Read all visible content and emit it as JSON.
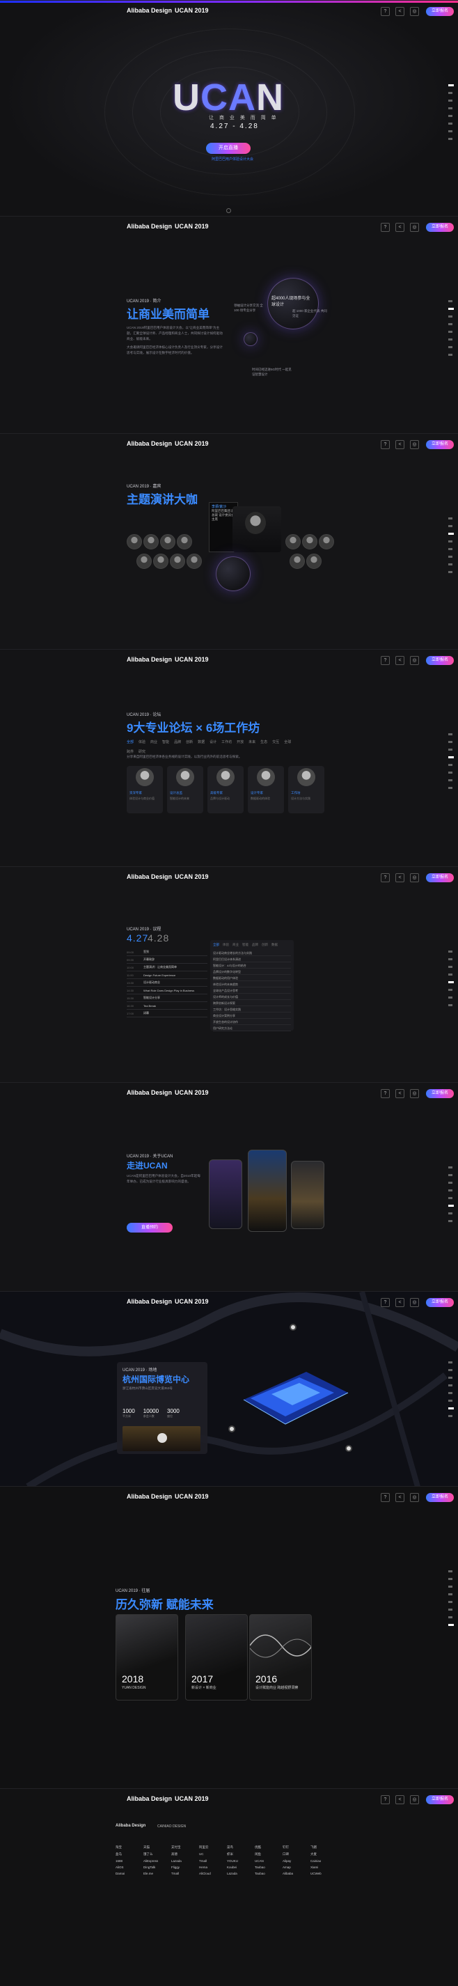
{
  "header": {
    "brand": "Alibaba Design",
    "event": "UCAN 2019",
    "buttons": [
      "?",
      "<",
      "◎"
    ],
    "register_label": "立即报名"
  },
  "hero": {
    "logo_prefix": "U",
    "logo_highlight": "CA",
    "logo_suffix": "N",
    "tagline": "让 商 业 美 而 简 单",
    "dates": "4.27 - 4.28",
    "live_button": "开启直播",
    "live_sub": "阿里巴巴用户体验设计大会"
  },
  "intro": {
    "eyebrow": "UCAN 2019 · 简介",
    "title": "让商业美而简单",
    "paragraphs": [
      "UCAN 2019阿里巴巴用户体验设计大会，以“让商业美而简单”为主题，汇聚全球设计师、产品经理和商业人士，共同探讨设计如何驱动商业、赋能未来。",
      "大会邀请阿里巴巴经济体核心设计负责人及行业顶尖专家，分享设计思考与实践，展示设计在数字经济时代的价值。"
    ],
    "stat_main": "超4000人现场参与全球设计",
    "stat_left": "领袖设计分享交流 全 100 场专业分享",
    "stat_right": "超 1000 家企业代表 共同见证",
    "stat_bottom": "时间已经迈进5G时代 一起见证智慧设计"
  },
  "speakers": {
    "eyebrow": "UCAN 2019 · 嘉宾",
    "title": "主题演讲大咖",
    "featured_name": "李振/紫沙",
    "featured_role": "阿里巴巴集团 副总裁 设计委员会主席"
  },
  "forums": {
    "eyebrow": "UCAN 2019 · 论坛",
    "title": "9大专业论坛 × 6场工作坊",
    "tabs": [
      "全部",
      "体验",
      "商业",
      "智能",
      "品牌",
      "创新",
      "数据",
      "设计",
      "工作坊",
      "开放",
      "未来",
      "生态",
      "交互",
      "全球",
      "跨界",
      "研究"
    ],
    "intro": "分享来自阿里巴巴经济体各业务线的设计实践，以及行业内外的前沿思考与探索。",
    "cards": [
      {
        "name": "资深专家",
        "desc": "体验设计与商业价值"
      },
      {
        "name": "设计总监",
        "desc": "智能设计的未来"
      },
      {
        "name": "高级专家",
        "desc": "品牌与设计驱动"
      },
      {
        "name": "设计专家",
        "desc": "数据驱动的体验"
      },
      {
        "name": "工作坊",
        "desc": "设计方法与实践"
      }
    ]
  },
  "agenda": {
    "eyebrow": "UCAN 2019 · 议程",
    "date_a": "4.27",
    "date_b": "4.28",
    "list": [
      {
        "t": "09:00",
        "n": "签到"
      },
      {
        "t": "09:30",
        "n": "开幕致辞"
      },
      {
        "t": "10:00",
        "n": "主题演讲：让商业美而简单"
      },
      {
        "t": "11:00",
        "n": "Design Future Experience"
      },
      {
        "t": "13:30",
        "n": "设计驱动商业"
      },
      {
        "t": "14:30",
        "n": "What Role Does Design Play in Business"
      },
      {
        "t": "15:30",
        "n": "智能设计分享"
      },
      {
        "t": "16:30",
        "n": "Tea Break"
      },
      {
        "t": "17:00",
        "n": "闭幕"
      }
    ],
    "panel_tabs": [
      "全部",
      "体验",
      "商业",
      "智能",
      "品牌",
      "创新",
      "数据"
    ],
    "panel_rows": [
      "设计驱动商业增长的方法与实践",
      "阿里巴巴设计体系演进",
      "智能设计：AI与设计的结合",
      "品牌设计的数字化转型",
      "数据驱动的用户体验",
      "体验设计的未来趋势",
      "全球化产品设计思考",
      "设计师的成长与价值",
      "跨界创新设计探索",
      "工作坊：设计思维实践",
      "商业设计案例分享",
      "开放生态的设计协作",
      "用户研究方法论"
    ]
  },
  "ucan": {
    "eyebrow": "UCAN 2019 · 关于UCAN",
    "title": "走进UCAN",
    "text": "UCAN是阿里巴巴用户体验设计大会，自2010年起每年举办，已成为设计行业极具影响力的盛会。",
    "button": "直播预约"
  },
  "venue": {
    "eyebrow": "UCAN 2019 · 场地",
    "title": "杭州国际博览中心",
    "address": "浙江省杭州市萧山区奔竞大道353号",
    "stats": [
      {
        "num": "1000",
        "lbl": "平方米"
      },
      {
        "num": "10000",
        "lbl": "参会人数"
      },
      {
        "num": "3000",
        "lbl": "座位"
      }
    ]
  },
  "history": {
    "eyebrow": "UCAN 2019 · 往届",
    "title": "历久弥新 赋能未来",
    "cards": [
      {
        "year": "2018",
        "sub": "YUAN DESIGN"
      },
      {
        "year": "2017",
        "sub": "新设计 × 新商业"
      },
      {
        "year": "2016",
        "sub": "设计赋能商业 跨越视野洞察"
      }
    ]
  },
  "partners": {
    "row1": [
      "Alibaba Design",
      "CAINIAO DESIGN"
    ],
    "logos": [
      "淘宝",
      "天猫",
      "支付宝",
      "阿里云",
      "菜鸟",
      "优酷",
      "钉钉",
      "飞猪",
      "盒马",
      "饿了么",
      "高德",
      "UC",
      "虾米",
      "闲鱼",
      "口碑",
      "大麦",
      "1688",
      "AliExpress",
      "Lazada",
      "Tmall",
      "YOUKU",
      "UCAN",
      "Alipay",
      "Cainiao",
      "AliOS",
      "DingTalk",
      "Fliggy",
      "Hema",
      "Koubei",
      "Taobao",
      "Amap",
      "Xiami",
      "Damai",
      "Ele.me",
      "Tmall",
      "AliCloud",
      "Lazada",
      "Taobao",
      "Alibaba",
      "UCWeb"
    ]
  },
  "colors": {
    "accent": "#3b8bff",
    "gradient_start": "#3a7bff",
    "gradient_end": "#ff4d9a"
  }
}
